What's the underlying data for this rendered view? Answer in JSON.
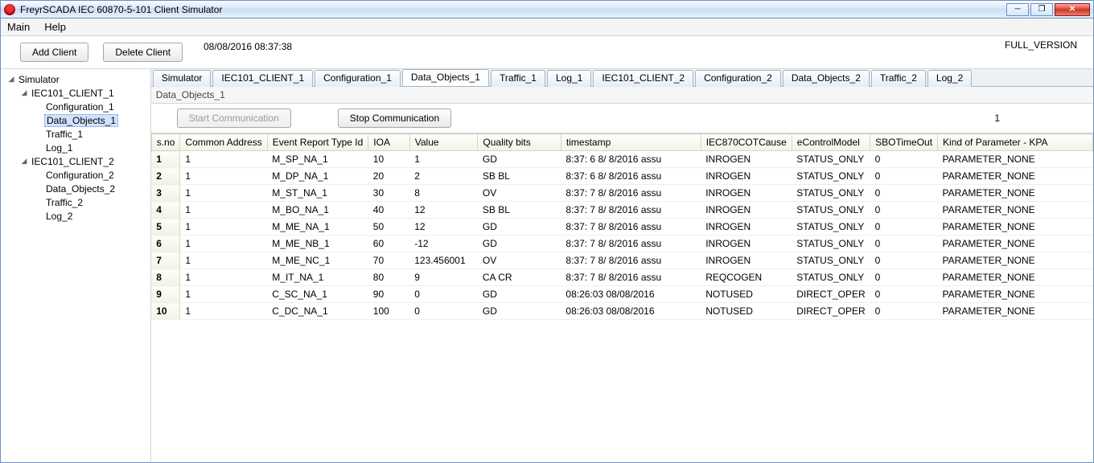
{
  "window": {
    "title": "FreyrSCADA IEC 60870-5-101 Client Simulator"
  },
  "menu": {
    "main": "Main",
    "help": "Help"
  },
  "toolbar": {
    "add_client": "Add Client",
    "delete_client": "Delete Client",
    "datetime": "08/08/2016 08:37:38",
    "version": "FULL_VERSION"
  },
  "tree": {
    "root": "Simulator",
    "client1": "IEC101_CLIENT_1",
    "client1_items": {
      "config": "Configuration_1",
      "data": "Data_Objects_1",
      "traffic": "Traffic_1",
      "log": "Log_1"
    },
    "client2": "IEC101_CLIENT_2",
    "client2_items": {
      "config": "Configuration_2",
      "data": "Data_Objects_2",
      "traffic": "Traffic_2",
      "log": "Log_2"
    }
  },
  "tabs": [
    "Simulator",
    "IEC101_CLIENT_1",
    "Configuration_1",
    "Data_Objects_1",
    "Traffic_1",
    "Log_1",
    "IEC101_CLIENT_2",
    "Configuration_2",
    "Data_Objects_2",
    "Traffic_2",
    "Log_2"
  ],
  "active_tab_index": 3,
  "panel": {
    "title": "Data_Objects_1",
    "start": "Start Communication",
    "stop": "Stop Communication",
    "count": "1"
  },
  "table": {
    "headers": {
      "sno": "s.no",
      "ca": "Common Address",
      "ert": "Event Report Type Id",
      "ioa": "IOA",
      "val": "Value",
      "qb": "Quality bits",
      "ts": "timestamp",
      "cot": "IEC870COTCause",
      "ecm": "eControlModel",
      "sbo": "SBOTimeOut",
      "kpa": "Kind of Parameter - KPA"
    },
    "rows": [
      {
        "sno": "1",
        "ca": "1",
        "ert": "M_SP_NA_1",
        "ioa": "10",
        "val": "1",
        "qb": "GD",
        "ts": "8:37: 6   8/ 8/2016  assu",
        "cot": "INROGEN",
        "ecm": "STATUS_ONLY",
        "sbo": "0",
        "kpa": "PARAMETER_NONE"
      },
      {
        "sno": "2",
        "ca": "1",
        "ert": "M_DP_NA_1",
        "ioa": "20",
        "val": "2",
        "qb": "SB BL",
        "ts": "8:37: 6   8/ 8/2016  assu",
        "cot": "INROGEN",
        "ecm": "STATUS_ONLY",
        "sbo": "0",
        "kpa": "PARAMETER_NONE"
      },
      {
        "sno": "3",
        "ca": "1",
        "ert": "M_ST_NA_1",
        "ioa": "30",
        "val": "8",
        "qb": "OV",
        "ts": "8:37: 7   8/ 8/2016  assu",
        "cot": "INROGEN",
        "ecm": "STATUS_ONLY",
        "sbo": "0",
        "kpa": "PARAMETER_NONE"
      },
      {
        "sno": "4",
        "ca": "1",
        "ert": "M_BO_NA_1",
        "ioa": "40",
        "val": "12",
        "qb": "SB BL",
        "ts": "8:37: 7   8/ 8/2016  assu",
        "cot": "INROGEN",
        "ecm": "STATUS_ONLY",
        "sbo": "0",
        "kpa": "PARAMETER_NONE"
      },
      {
        "sno": "5",
        "ca": "1",
        "ert": "M_ME_NA_1",
        "ioa": "50",
        "val": "12",
        "qb": "GD",
        "ts": "8:37: 7   8/ 8/2016  assu",
        "cot": "INROGEN",
        "ecm": "STATUS_ONLY",
        "sbo": "0",
        "kpa": "PARAMETER_NONE"
      },
      {
        "sno": "6",
        "ca": "1",
        "ert": "M_ME_NB_1",
        "ioa": "60",
        "val": "-12",
        "qb": "GD",
        "ts": "8:37: 7   8/ 8/2016  assu",
        "cot": "INROGEN",
        "ecm": "STATUS_ONLY",
        "sbo": "0",
        "kpa": "PARAMETER_NONE"
      },
      {
        "sno": "7",
        "ca": "1",
        "ert": "M_ME_NC_1",
        "ioa": "70",
        "val": "123.456001",
        "qb": "OV",
        "ts": "8:37: 7   8/ 8/2016  assu",
        "cot": "INROGEN",
        "ecm": "STATUS_ONLY",
        "sbo": "0",
        "kpa": "PARAMETER_NONE"
      },
      {
        "sno": "8",
        "ca": "1",
        "ert": "M_IT_NA_1",
        "ioa": "80",
        "val": "9",
        "qb": "CA CR",
        "ts": "8:37: 7   8/ 8/2016  assu",
        "cot": "REQCOGEN",
        "ecm": "STATUS_ONLY",
        "sbo": "0",
        "kpa": "PARAMETER_NONE"
      },
      {
        "sno": "9",
        "ca": "1",
        "ert": "C_SC_NA_1",
        "ioa": "90",
        "val": "0",
        "qb": "GD",
        "ts": "08:26:03 08/08/2016",
        "cot": "NOTUSED",
        "ecm": "DIRECT_OPER",
        "sbo": "0",
        "kpa": "PARAMETER_NONE"
      },
      {
        "sno": "10",
        "ca": "1",
        "ert": "C_DC_NA_1",
        "ioa": "100",
        "val": "0",
        "qb": "GD",
        "ts": "08:26:03 08/08/2016",
        "cot": "NOTUSED",
        "ecm": "DIRECT_OPER",
        "sbo": "0",
        "kpa": "PARAMETER_NONE"
      }
    ]
  }
}
